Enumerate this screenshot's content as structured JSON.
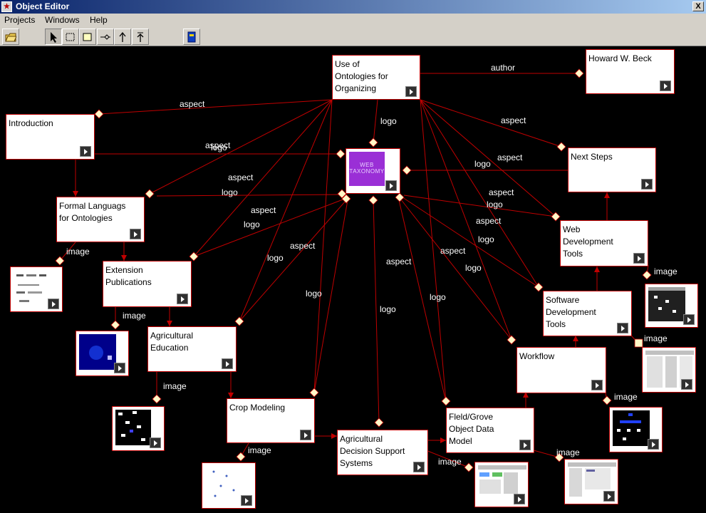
{
  "window": {
    "title": "Object Editor",
    "close_glyph": "X"
  },
  "menu": {
    "items": [
      "Projects",
      "Windows",
      "Help"
    ]
  },
  "toolbar": {
    "tools": [
      "open-folder-icon",
      "select-arrow-icon",
      "marquee-icon",
      "rectangle-icon",
      "link-icon",
      "up-arrow-icon",
      "up-line-icon",
      "book-icon"
    ]
  },
  "logo": {
    "text": "WEB TAXONOMY",
    "color": "#9a2fd6"
  },
  "nodes": {
    "use_of_ontologies": "Use of Ontologies for Organizing",
    "howard_beck": "Howard W. Beck",
    "introduction": "Introduction",
    "next_steps": "Next Steps",
    "formal_languages": "Formal Languags for Ontologies",
    "web_dev_tools": "Web Development Tools",
    "extension_pubs": "Extension Publications",
    "software_dev_tools": "Software Development Tools",
    "ag_education": "Agricultural Education",
    "workflow": "Workflow",
    "crop_modeling": "Crop Modeling",
    "field_grove": "Fleld/Grove Object Data Model",
    "ag_decision": "Agricultural Decision Support Systems"
  },
  "link_labels": {
    "author": "author",
    "aspect": "aspect",
    "logo": "logo",
    "image": "image"
  },
  "colors": {
    "link": "#c00000",
    "accent": "#0a246a",
    "marker": "#fff8c8"
  }
}
